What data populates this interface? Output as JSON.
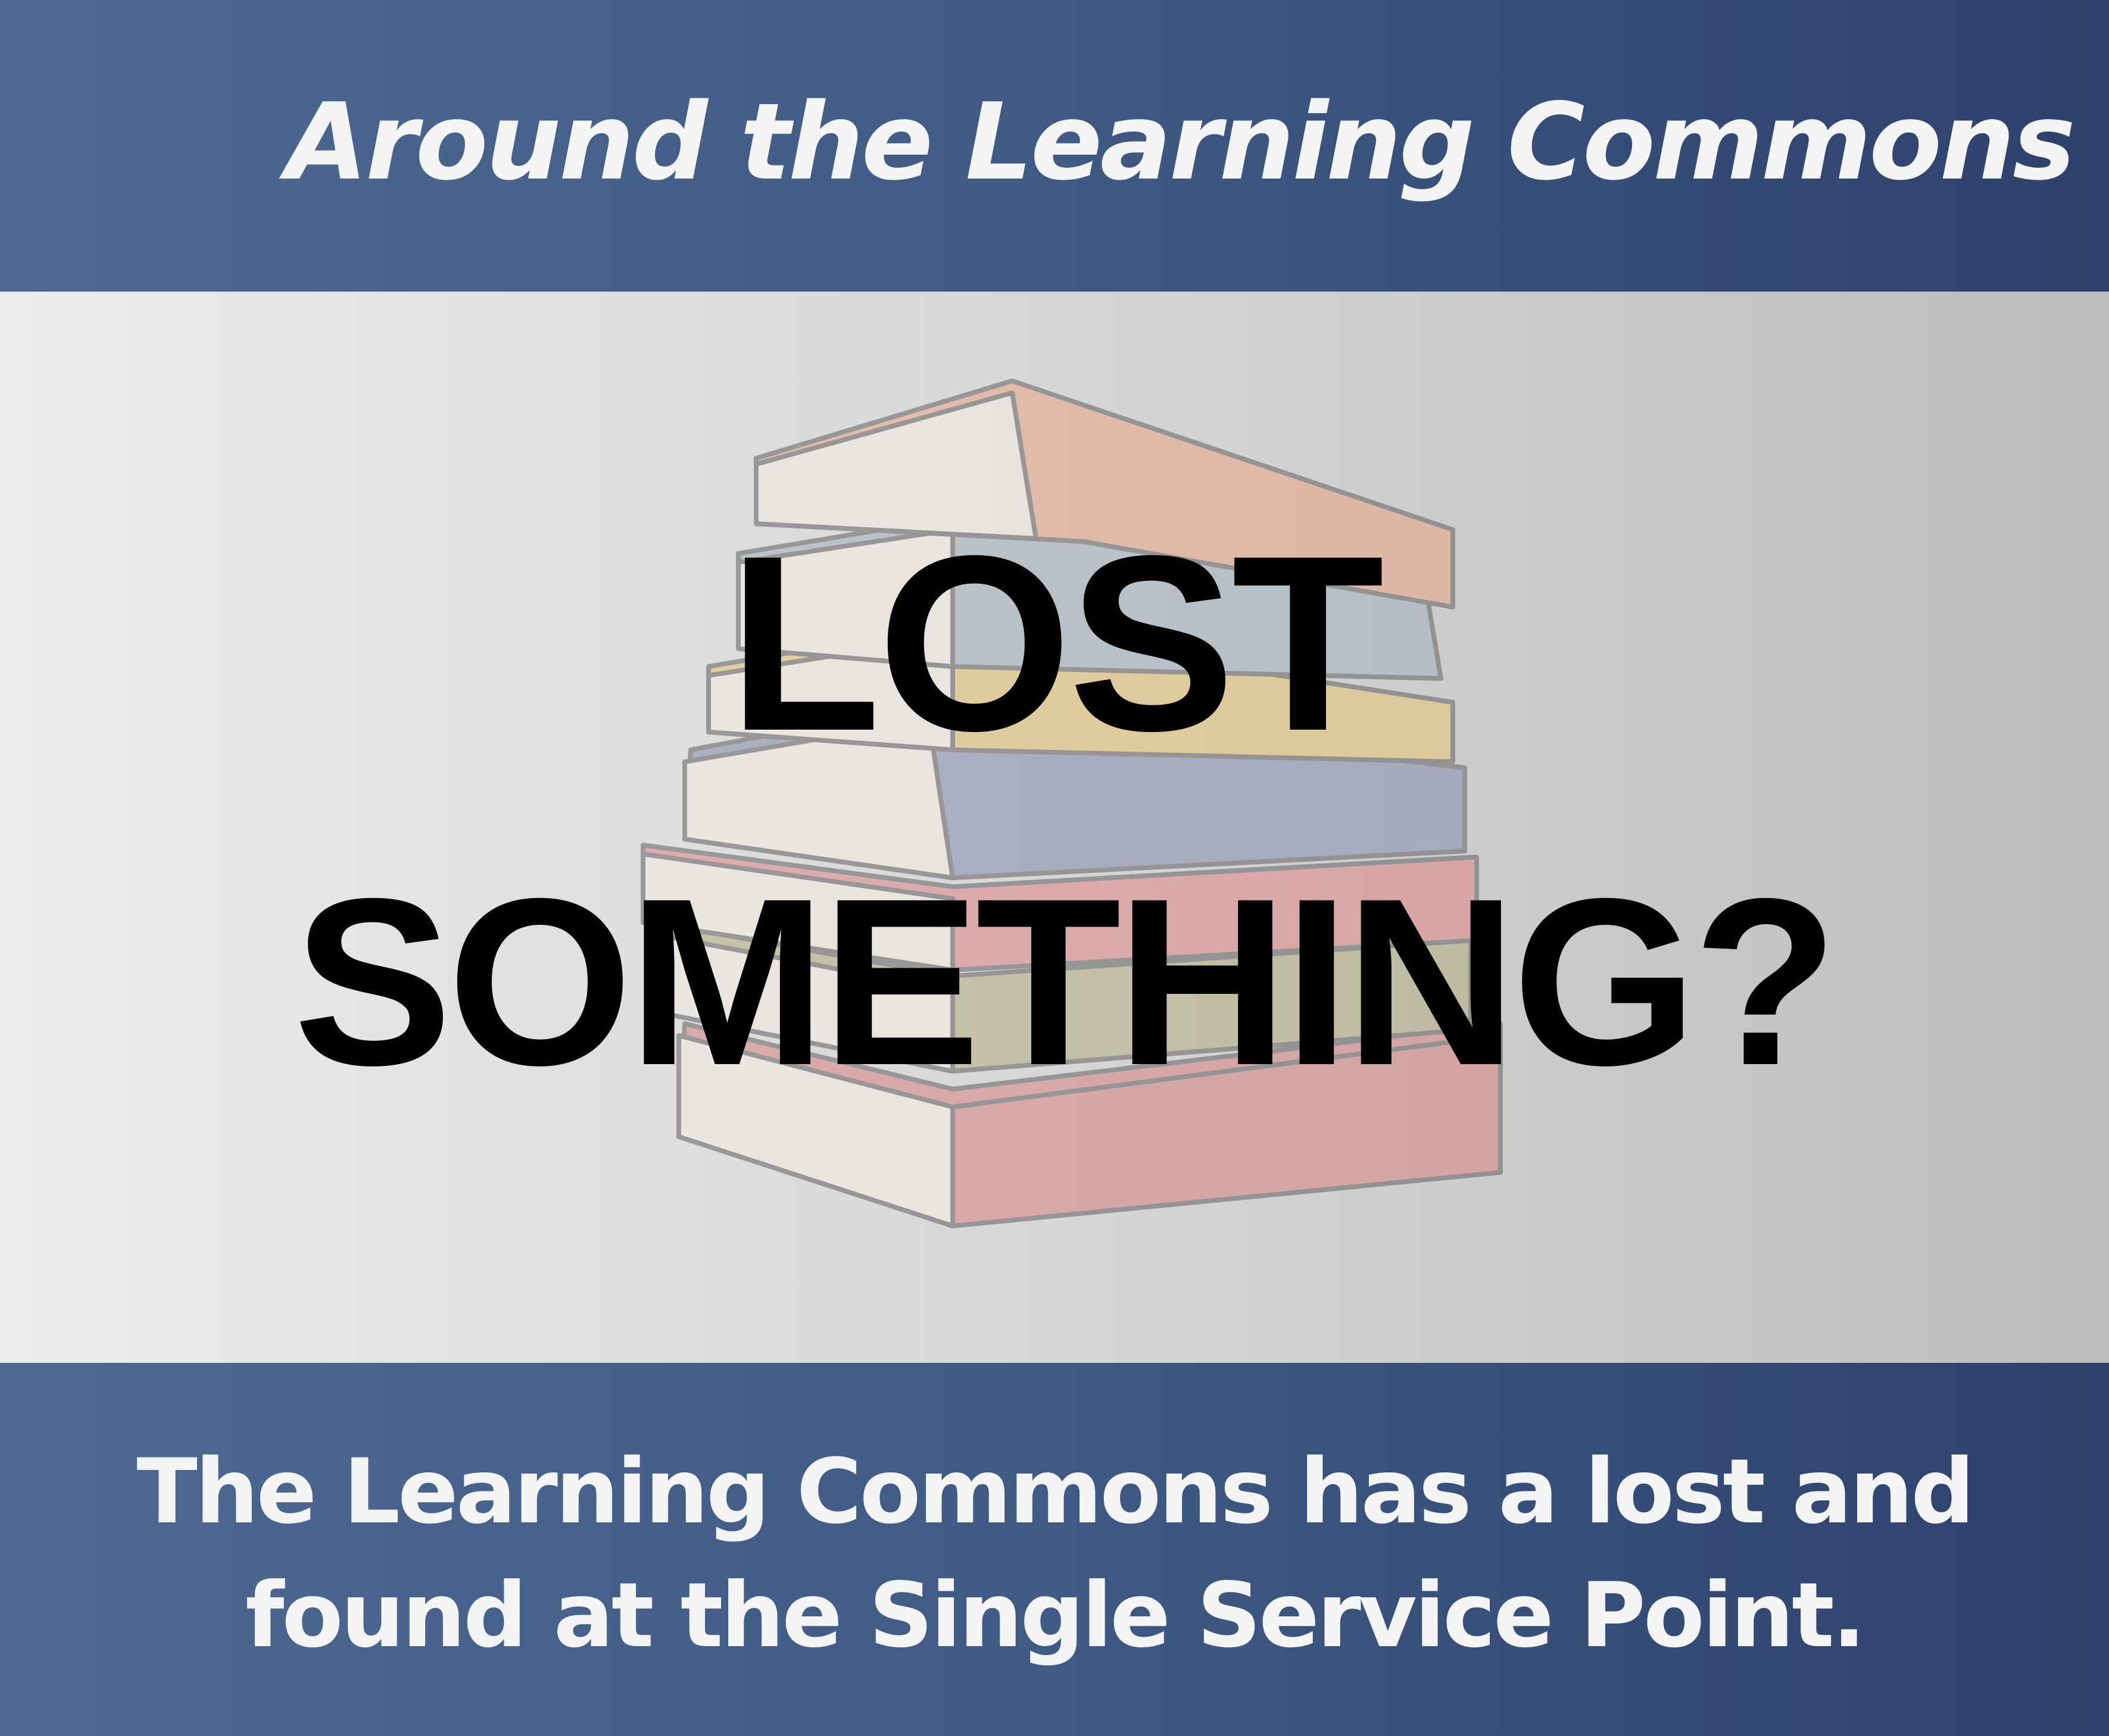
{
  "header": {
    "title": "Around the Learning Commons"
  },
  "headline": {
    "line1": "LOST",
    "line2": "SOMETHING?"
  },
  "illustration": {
    "name": "stack-of-books-icon",
    "book_colors": [
      "#e8a98f",
      "#a8b4c2",
      "#e6c57a",
      "#8d96b3",
      "#df8f8f",
      "#b7b389",
      "#d98c8c"
    ]
  },
  "footer": {
    "line1": "The Learning Commons has a lost and",
    "line2": "found at the Single Service Point."
  },
  "colors": {
    "band": "#3f5a84",
    "band_dark": "#2d416b",
    "middle_light": "#ececec",
    "middle_dark": "#bdbdbd",
    "headline_text": "#000000",
    "band_text": "#f4f4f4"
  }
}
